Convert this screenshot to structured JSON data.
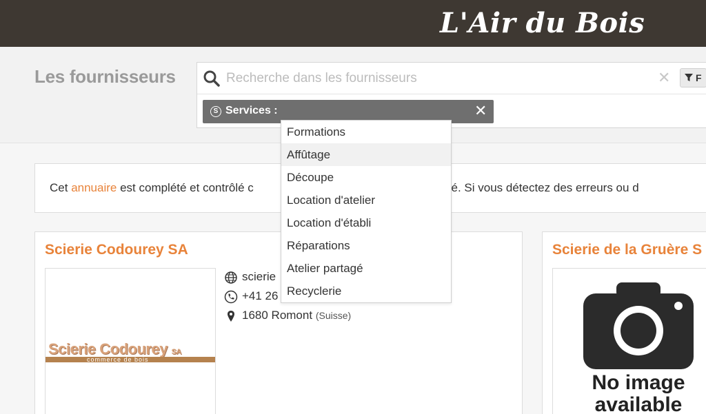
{
  "brand": "L'Air du Bois",
  "page_title": "Les fournisseurs",
  "search": {
    "placeholder": "Recherche dans les fournisseurs",
    "value": "",
    "clear_icon": "close-icon",
    "filter_label": "F"
  },
  "tag": {
    "icon_letter": "S",
    "label": "Services :",
    "close": "✕"
  },
  "info": {
    "prefix": "Cet ",
    "link": "annuaire",
    "middle": " est complété et contrôlé c",
    "suffix": "munauté. Si vous détectez des erreurs ou d"
  },
  "dropdown": {
    "items": [
      "Formations",
      "Affûtage",
      "Découpe",
      "Location d'atelier",
      "Location d'établi",
      "Réparations",
      "Atelier partagé",
      "Recyclerie"
    ],
    "hovered_index": 1
  },
  "cards": [
    {
      "title": "Scierie Codourey SA",
      "logo_text": "Scierie Codourey",
      "logo_suffix": "SA",
      "logo_sub": "commerce de bois",
      "website": "scierie",
      "phone": "+41 26",
      "city": "1680 Romont",
      "country": "(Suisse)"
    },
    {
      "title": "Scierie de la Gruère S",
      "no_image_line1": "No image",
      "no_image_line2": "available"
    }
  ],
  "colors": {
    "accent": "#e8833a",
    "topbar": "#3e3832",
    "tag_bg": "#6f6f6f"
  }
}
